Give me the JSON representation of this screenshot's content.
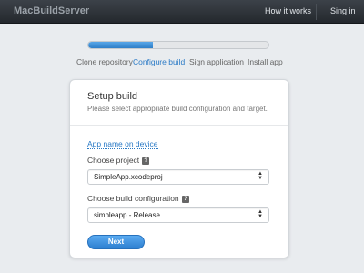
{
  "navbar": {
    "brand": "MacBuildServer",
    "links": [
      {
        "label": "How it works"
      },
      {
        "label": "Sing in"
      }
    ]
  },
  "progress": {
    "fraction": 0.36
  },
  "steps": [
    {
      "label": "Clone repository",
      "active": false
    },
    {
      "label": "Configure build",
      "active": true
    },
    {
      "label": "Sign application",
      "active": false
    },
    {
      "label": "Install app",
      "active": false
    }
  ],
  "card": {
    "title": "Setup build",
    "subtitle": "Please select appropriate build configuration and target.",
    "app_name_link": "App name on device",
    "project": {
      "label": "Choose project",
      "help_icon": "question-icon",
      "value": "SimpleApp.xcodeproj"
    },
    "configuration": {
      "label": "Choose build configuration",
      "help_icon": "question-icon",
      "value": "simpleapp - Release"
    },
    "next_label": "Next"
  },
  "colors": {
    "accent": "#2a7ac6",
    "navbar": "#2e3338"
  }
}
